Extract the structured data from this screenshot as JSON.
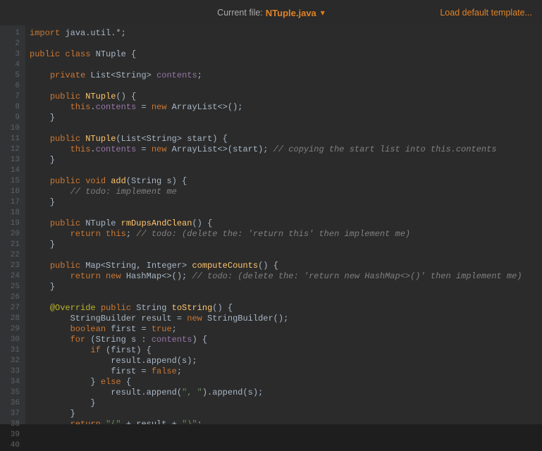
{
  "header": {
    "label": "Current file:",
    "filename": "NTuple.java",
    "loadTemplate": "Load default template..."
  },
  "code": {
    "lines": [
      {
        "n": 1,
        "html": "<span class='kw'>import</span> java.util.*;"
      },
      {
        "n": 2,
        "html": ""
      },
      {
        "n": 3,
        "html": "<span class='kw'>public class</span> NTuple {"
      },
      {
        "n": 4,
        "html": ""
      },
      {
        "n": 5,
        "html": "    <span class='kw'>private</span> List&lt;String&gt; <span class='field'>contents</span>;"
      },
      {
        "n": 6,
        "html": ""
      },
      {
        "n": 7,
        "html": "    <span class='kw'>public</span> <span class='fn'>NTuple</span>() {"
      },
      {
        "n": 8,
        "html": "        <span class='kw'>this</span>.<span class='field'>contents</span> = <span class='kw'>new</span> ArrayList&lt;&gt;();"
      },
      {
        "n": 9,
        "html": "    }"
      },
      {
        "n": 10,
        "html": ""
      },
      {
        "n": 11,
        "html": "    <span class='kw'>public</span> <span class='fn'>NTuple</span>(List&lt;String&gt; start) {"
      },
      {
        "n": 12,
        "html": "        <span class='kw'>this</span>.<span class='field'>contents</span> = <span class='kw'>new</span> ArrayList&lt;&gt;(start); <span class='cmt'>// copying the start list into this.contents</span>"
      },
      {
        "n": 13,
        "html": "    }"
      },
      {
        "n": 14,
        "html": ""
      },
      {
        "n": 15,
        "html": "    <span class='kw'>public void</span> <span class='fn'>add</span>(String s) {"
      },
      {
        "n": 16,
        "html": "        <span class='cmt'>// todo: implement me</span>"
      },
      {
        "n": 17,
        "html": "    }"
      },
      {
        "n": 18,
        "html": ""
      },
      {
        "n": 19,
        "html": "    <span class='kw'>public</span> NTuple <span class='fn'>rmDupsAndClean</span>() {"
      },
      {
        "n": 20,
        "html": "        <span class='kw'>return this</span>; <span class='cmt'>// todo: (delete the: 'return this' then implement me)</span>"
      },
      {
        "n": 21,
        "html": "    }"
      },
      {
        "n": 22,
        "html": ""
      },
      {
        "n": 23,
        "html": "    <span class='kw'>public</span> Map&lt;String, Integer&gt; <span class='fn'>computeCounts</span>() {"
      },
      {
        "n": 24,
        "html": "        <span class='kw'>return new</span> HashMap&lt;&gt;(); <span class='cmt'>// todo: (delete the: 'return new HashMap&lt;&gt;()' then implement me)</span>"
      },
      {
        "n": 25,
        "html": "    }"
      },
      {
        "n": 26,
        "html": ""
      },
      {
        "n": 27,
        "html": "    <span class='ann'>@Override</span> <span class='kw'>public</span> String <span class='fn'>toString</span>() {"
      },
      {
        "n": 28,
        "html": "        StringBuilder result = <span class='kw'>new</span> StringBuilder();"
      },
      {
        "n": 29,
        "html": "        <span class='kw'>boolean</span> first = <span class='kw'>true</span>;"
      },
      {
        "n": 30,
        "html": "        <span class='kw'>for</span> (String s : <span class='field'>contents</span>) {"
      },
      {
        "n": 31,
        "html": "            <span class='kw'>if</span> (first) {"
      },
      {
        "n": 32,
        "html": "                result.append(s);"
      },
      {
        "n": 33,
        "html": "                first = <span class='kw'>false</span>;"
      },
      {
        "n": 34,
        "html": "            } <span class='kw'>else</span> {"
      },
      {
        "n": 35,
        "html": "                result.append(<span class='str'>\", \"</span>).append(s);"
      },
      {
        "n": 36,
        "html": "            }"
      },
      {
        "n": 37,
        "html": "        }"
      },
      {
        "n": 38,
        "html": "        <span class='kw'>return</span> <span class='str'>\"(\"</span> + result + <span class='str'>\")\"</span>;"
      },
      {
        "n": 39,
        "html": "    }"
      },
      {
        "n": 40,
        "html": "}"
      }
    ]
  }
}
